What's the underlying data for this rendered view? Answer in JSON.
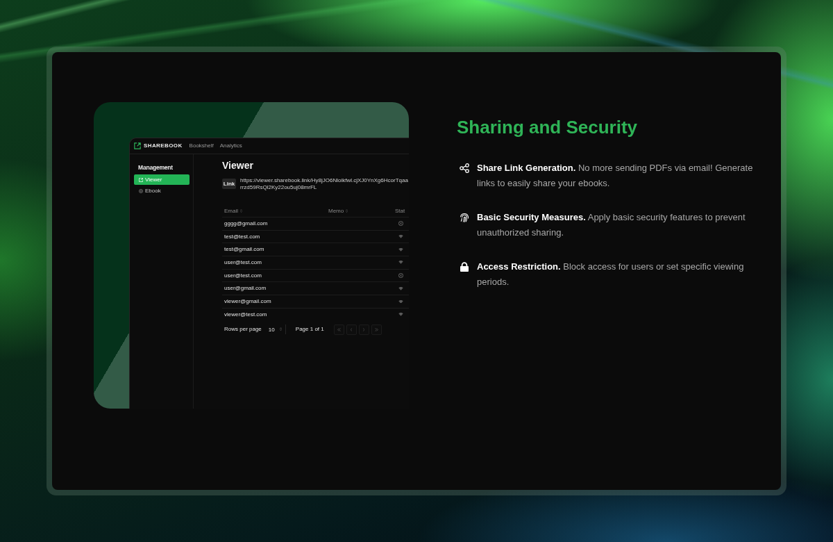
{
  "preview": {
    "app_window": {
      "logo_text": "SHAREBOOK",
      "nav": [
        "Bookshelf",
        "Analytics"
      ],
      "sidebar": {
        "heading": "Management",
        "items": [
          {
            "label": "Viewer",
            "selected": true
          },
          {
            "label": "Ebook",
            "selected": false
          }
        ]
      },
      "title": "Viewer",
      "link": {
        "label": "Link",
        "url": "https://viewer.sharebook.link/Hy8jJO6Nloikfwl.cjXJ0YnXg6HcorTqaarrzd59RsQl2Ky22ou5uj08mrFL"
      },
      "table": {
        "columns": [
          {
            "label": "Email",
            "sortable": true
          },
          {
            "label": "Memo",
            "sortable": true
          },
          {
            "label": "Stat",
            "sortable": false
          }
        ],
        "rows": [
          {
            "email": "gggg@gmail.com",
            "blocked": true
          },
          {
            "email": "test@test.com",
            "blocked": false
          },
          {
            "email": "test@gmail.com",
            "blocked": false
          },
          {
            "email": "user@test.com",
            "blocked": false
          },
          {
            "email": "user@test.com",
            "blocked": true
          },
          {
            "email": "user@gmail.com",
            "blocked": false
          },
          {
            "email": "viewer@gmail.com",
            "blocked": false
          },
          {
            "email": "viewer@test.com",
            "blocked": false
          }
        ]
      },
      "pagination": {
        "rows_per_page_label": "Rows per page",
        "rows_per_page": "10",
        "page_info": "Page 1 of 1"
      }
    }
  },
  "features_section": {
    "title": "Sharing and Security",
    "features": [
      {
        "text": "**Share Link Generation.** No more sending PDFs via email! Generate links to easily share your ebooks."
      },
      {
        "text": "**Basic Security Measures.** Apply basic security features to prevent unauthorized sharing."
      },
      {
        "text": "**Access Restriction.** Block access for users or set specific viewing periods."
      }
    ]
  }
}
